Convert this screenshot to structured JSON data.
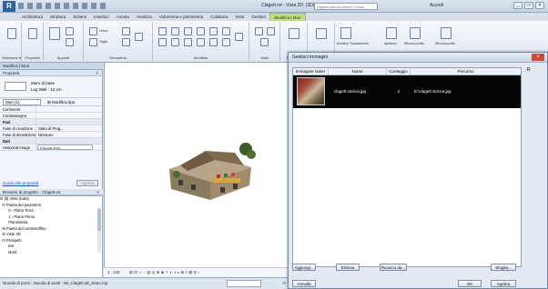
{
  "titlebar": {
    "logo": "R",
    "title": "Clagett.rvt - Vista 3D: {3D}",
    "search_placeholder": "Digitare parola chiave o frase",
    "user": "Accedi",
    "btn_min": "_",
    "btn_max": "□",
    "btn_close": "×"
  },
  "tabs": [
    "Architettura",
    "Struttura",
    "Sistemi",
    "Inserisci",
    "Annota",
    "Analizza",
    "Volumetria e planimetria",
    "Collabora",
    "Vista",
    "Gestisci",
    "Modifica | Muri"
  ],
  "ribbon": {
    "groups": [
      "Selezione ▾",
      "Proprietà",
      "Appunti",
      "Geometria",
      "Modifica",
      "Vista",
      "Modalità",
      "Crea",
      "Modifica muro"
    ],
    "tool_labels": [
      "Unisci",
      "Taglia",
      "Modifica Tracciamento",
      "Apertura",
      "Ritocca profilo",
      "Ritocca profilo"
    ]
  },
  "context_header": "Modifica | Muri",
  "properties": {
    "header": "Proprietà",
    "type_line1": "Muro di base",
    "type_line2": "Log Wall - 12 cm",
    "filter": "Muri (1)",
    "edit_type": "Modifica tipo",
    "rows": [
      {
        "k": "Commenti",
        "v": "",
        "cat": false
      },
      {
        "k": "Contrassegno",
        "v": "",
        "cat": false
      },
      {
        "k": "Fasi",
        "v": "",
        "cat": true
      },
      {
        "k": "Fase di creazione",
        "v": "Stato di Prog...",
        "cat": false
      },
      {
        "k": "Fase di demolizione",
        "v": "Nessuno",
        "cat": false
      },
      {
        "k": "Dati",
        "v": "",
        "cat": true
      },
      {
        "k": "Historical Image",
        "v": "Clagett stori...",
        "cat": false
      }
    ],
    "help_link": "Guida alle proprietà",
    "apply_button": "Applica"
  },
  "browser": {
    "header": "Browser di progetto - Clagett.rvt",
    "items": [
      "⊟ [0] Viste (tutto)",
      "  ⊟ Pianta dei pavimenti",
      "        0 - Piano Terra",
      "        1 - Piano Primo",
      "        Planimetria",
      "  ⊞ Pianta del controsoffitto",
      "  ⊞ Viste 3D",
      "  ⊟ Prospetti",
      "        Est",
      "        Nord"
    ]
  },
  "viewctrl": {
    "scale": "1 : 100",
    "icons": "⊞ ⊡ ☼ ◌ ◍ ◎ ⊕ ◈ ✧ ◐ ◑ ◒ ⊗ ◓ ⊠ ⊘ ‹"
  },
  "status": {
    "text": "Nuvola di punti : Nuvola di punti : 06_Clagett all_clean.rcp",
    "right_value": ":0"
  },
  "dialog": {
    "title": "Gestisci immagini",
    "columns": [
      "Immagine raster",
      "Nome",
      "Conteggio",
      "Percorso"
    ],
    "rows": [
      {
        "name": "clagett storica.jpg",
        "count": "1",
        "path": "E:\\clagett storica.jpg"
      }
    ],
    "buttons": {
      "add": "Aggiungi...",
      "delete": "Elimina",
      "reload": "Ricarica da...",
      "browse": "Sfoglia...",
      "ok": "OK",
      "cancel": "Annulla",
      "apply": "Applica"
    },
    "right_strip": "R"
  }
}
